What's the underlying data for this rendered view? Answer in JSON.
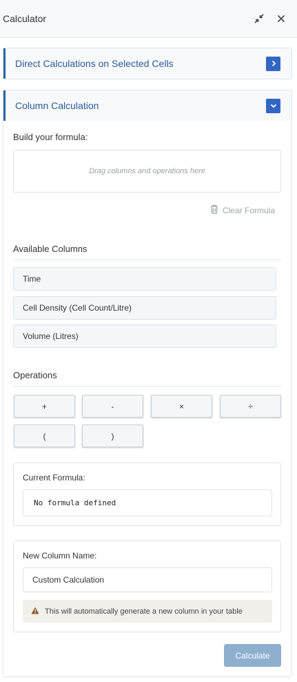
{
  "header": {
    "title": "Calculator",
    "minimize_icon": "compress-arrows-icon",
    "close_icon": "close-icon"
  },
  "direct_section": {
    "label": "Direct Calculations on Selected Cells",
    "toggle_icon": "chevron-right-icon",
    "expanded": false
  },
  "column_section": {
    "label": "Column Calculation",
    "toggle_icon": "chevron-down-icon",
    "expanded": true,
    "build_label": "Build your formula:",
    "dropzone_placeholder": "Drag columns and operations here",
    "clear_label": "Clear Formula",
    "available_columns_label": "Available Columns",
    "columns": [
      "Time",
      "Cell Density (Cell Count/Litre)",
      "Volume (Litres)"
    ],
    "operations_label": "Operations",
    "operations": [
      "+",
      "-",
      "×",
      "÷",
      "(",
      ")"
    ],
    "current_formula_label": "Current Formula:",
    "current_formula_value": "No formula defined",
    "new_column_label": "New Column Name:",
    "new_column_value": "Custom Calculation",
    "notice_text": "This will automatically generate a new column in your table",
    "calculate_label": "Calculate"
  },
  "colors": {
    "accent": "#2b63a6",
    "chevron_bg": "#3366c4",
    "calculate_bg": "#8fafcf",
    "warning_icon": "#8a5a2b"
  }
}
